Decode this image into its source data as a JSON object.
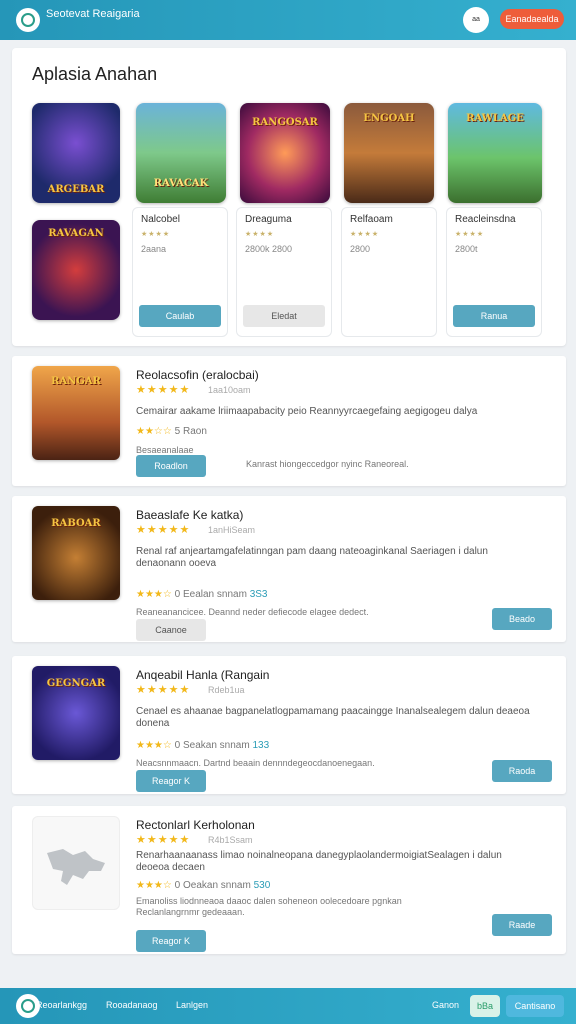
{
  "header": {
    "brand": "Seotevat Reaigaria",
    "avatar_label": "aa",
    "action_label": "Eanadaealda"
  },
  "section": {
    "title": "Aplasia Anahan"
  },
  "featured": [
    {
      "name": "Nalcobel",
      "stars": "★★★★",
      "meta": "2aana",
      "button": "Caulab",
      "style": "teal"
    },
    {
      "name": "Dreaguma",
      "stars": "★★★★",
      "meta": "2800k 2800",
      "button": "Eledat",
      "style": "gray"
    },
    {
      "name": "Relfaoam",
      "stars": "★★★★",
      "meta": "2800",
      "button": "",
      "style": "none"
    },
    {
      "name": "Reacleinsdna",
      "stars": "★★★★",
      "meta": "2800t",
      "button": "Ranua",
      "style": "teal"
    }
  ],
  "cover_titles": [
    "ARGEBAR",
    "RAVACAK",
    "RANGOSAR",
    "ENGOAH",
    "RAWLAGE",
    "RAVAGAN",
    "RANGAR",
    "RABOAR",
    "GEGNGAR"
  ],
  "list": [
    {
      "title": "Reolacsofin (eralocbai)",
      "stars": "★★★★★",
      "count": "1aa10oam",
      "desc": "Cemairar aakame lriimaapabacity peio Reannyyrcaegefaing aegigogeu dalya",
      "rate_stars": "★★☆☆",
      "rate_num": "5",
      "rate_text": "Raon",
      "note": "Besaeanalaae",
      "action": "Roadlon",
      "side_text": "Kanrast hiongeccedgor nyinc Raneoreal."
    },
    {
      "title": "Baeaslafe Ke katka)",
      "stars": "★★★★★",
      "count": "1anHiSeam",
      "desc": "Renal raf anjeartamgafelatinngan pam daang nateoaginkanal Saeriagen i dalun denaonann ooeva",
      "rate_stars": "★★★☆",
      "rate_num": "0",
      "rate_text": "Eealan snnam",
      "rate_hl": "3S3",
      "note": "Reaneanancicee. Deannd neder defiecode elagee dedect.",
      "action": "Caanoe",
      "right_button": "Beado"
    },
    {
      "title": "Anqeabil Hanla (Rangain",
      "stars": "★★★★★",
      "count": "Rdeb1ua",
      "desc": "Cenael es ahaanae bagpanelatlogpamamang paacaingge Inanalsealegem dalun deaeoa donena",
      "rate_stars": "★★★☆",
      "rate_num": "0",
      "rate_text": "Seakan snnam",
      "rate_hl": "133",
      "note": "Neacsnnmaacn. Dartnd beaain dennndegeocdanoenegaan.",
      "action": "Reagor K",
      "right_button": "Raoda"
    },
    {
      "title": "Rectonlarl Kerholonan",
      "stars": "★★★★★",
      "count": "R4b1Ssam",
      "desc": "Renarhaanaanass limao noinalneopana danegyplaolandermoigiatSealagen i dalun deoeoa decaen",
      "rate_stars": "★★★☆",
      "rate_num": "0",
      "rate_text": "Oeakan snnam",
      "rate_hl": "530",
      "note": "Emanoliss liodnneaoa daaoc dalen soheneon oolecedoare pgnkan Reclanlangrnmr gedeaaan.",
      "action": "Reagor K",
      "right_button": "Raade"
    }
  ],
  "footer": {
    "label_1": "Reoarlankgg",
    "label_2": "Rooadanaog",
    "label_3": "Lanlgen",
    "label_4": "Ganon",
    "pill_1": "bBa",
    "pill_2": "Cantisano"
  },
  "colors": {
    "accent": "#2ea6c6",
    "button_teal": "#57a7c0",
    "cta": "#ee5d3a",
    "star": "#f2b81a"
  }
}
